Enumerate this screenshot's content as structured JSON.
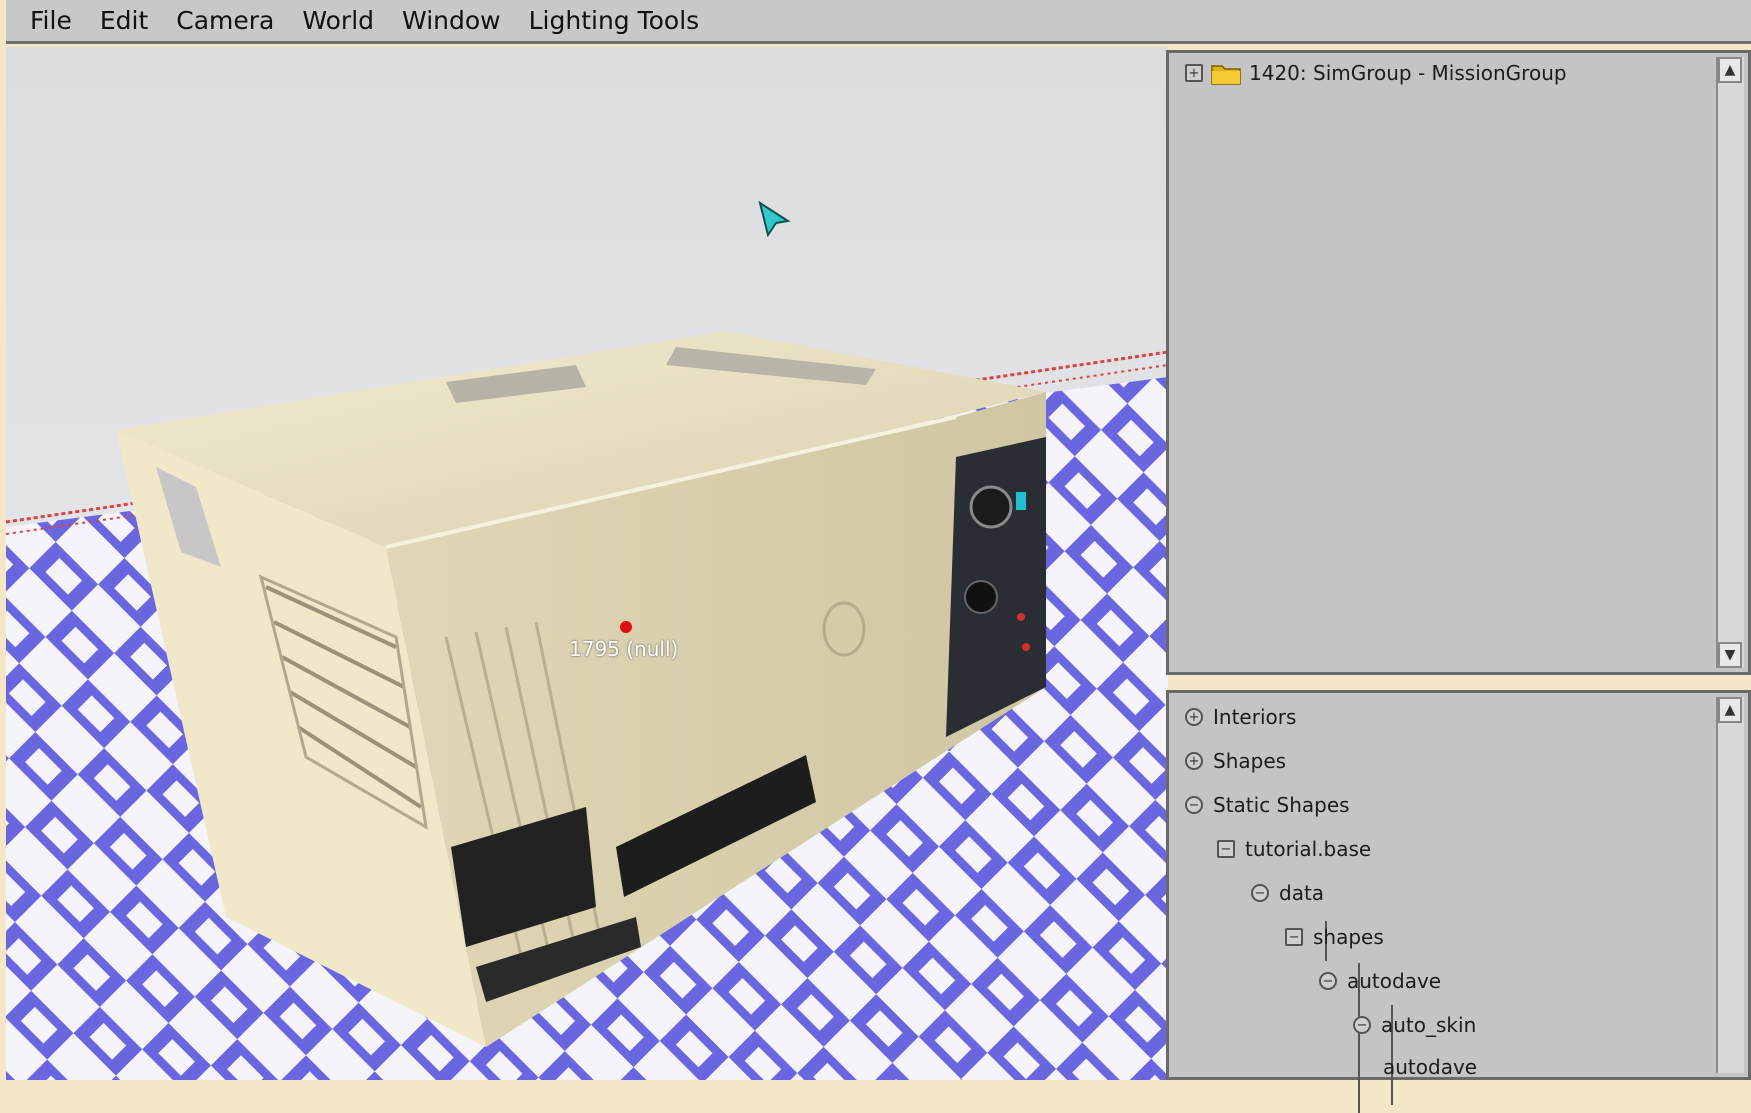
{
  "menu": {
    "items": [
      "File",
      "Edit",
      "Camera",
      "World",
      "Window",
      "Lighting Tools"
    ]
  },
  "viewport": {
    "object_label": "1795 (null)",
    "floor_color": "#6a66e0",
    "object_color": "#ece2c0"
  },
  "scene_tree": {
    "root_label": "1420: SimGroup - MissionGroup"
  },
  "creator_tree": {
    "items": [
      {
        "label": "Interiors"
      },
      {
        "label": "Shapes"
      },
      {
        "label": "Static Shapes"
      },
      {
        "label": "tutorial.base"
      },
      {
        "label": "data"
      },
      {
        "label": "shapes"
      },
      {
        "label": "autodave"
      },
      {
        "label": "auto_skin"
      },
      {
        "label": "autodave"
      }
    ]
  },
  "icons": [
    "folder-icon",
    "arrow-cursor-icon",
    "scroll-up-icon",
    "scroll-down-icon"
  ]
}
